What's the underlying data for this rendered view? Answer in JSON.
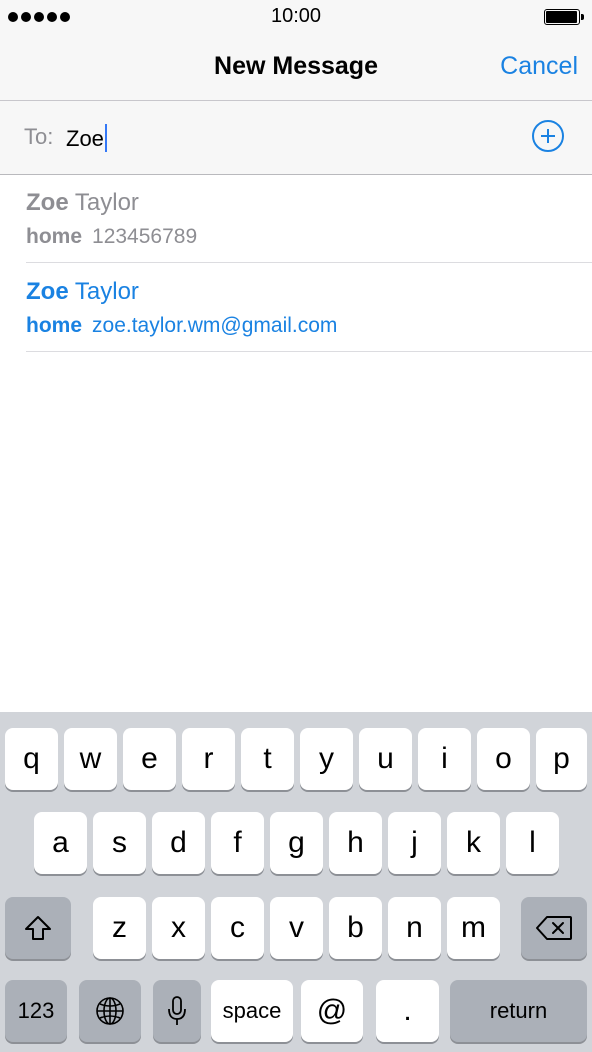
{
  "status_bar": {
    "time": "10:00"
  },
  "nav": {
    "title": "New Message",
    "cancel_label": "Cancel"
  },
  "to_field": {
    "label": "To:",
    "value": "Zoe"
  },
  "suggestions": [
    {
      "first": "Zoe",
      "last": "Taylor",
      "type": "home",
      "value": "123456789",
      "state": "dimmed"
    },
    {
      "first": "Zoe",
      "last": "Taylor",
      "type": "home",
      "value": "zoe.taylor.wm@gmail.com",
      "state": "active"
    }
  ],
  "keyboard": {
    "row1": [
      "q",
      "w",
      "e",
      "r",
      "t",
      "y",
      "u",
      "i",
      "o",
      "p"
    ],
    "row2": [
      "a",
      "s",
      "d",
      "f",
      "g",
      "h",
      "j",
      "k",
      "l"
    ],
    "row3": [
      "z",
      "x",
      "c",
      "v",
      "b",
      "n",
      "m"
    ],
    "numbers_label": "123",
    "space_label": "space",
    "at_label": "@",
    "period_label": ".",
    "return_label": "return"
  },
  "colors": {
    "accent": "#1a82e2",
    "dimmed_text": "#8e8e93",
    "keyboard_bg": "#d1d4d9",
    "function_key": "#abb0b8"
  },
  "icons": [
    "signal-dots-icon",
    "battery-icon",
    "add-contact-icon",
    "shift-icon",
    "backspace-icon",
    "globe-icon",
    "microphone-icon"
  ]
}
